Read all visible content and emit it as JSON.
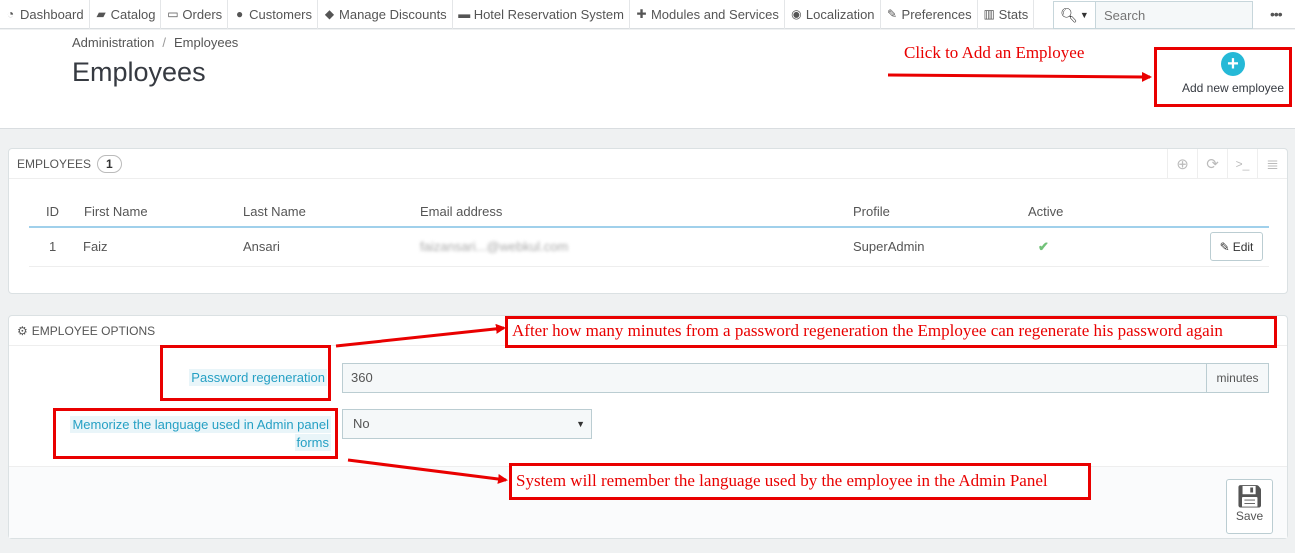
{
  "nav": {
    "items": [
      {
        "label": "Dashboard",
        "icon": "dashboard-icon"
      },
      {
        "label": "Catalog",
        "icon": "book-icon"
      },
      {
        "label": "Orders",
        "icon": "credit-card-icon"
      },
      {
        "label": "Customers",
        "icon": "users-icon"
      },
      {
        "label": "Manage Discounts",
        "icon": "tags-icon"
      },
      {
        "label": "Hotel Reservation System",
        "icon": "bed-icon"
      },
      {
        "label": "Modules and Services",
        "icon": "puzzle-icon"
      },
      {
        "label": "Localization",
        "icon": "globe-icon"
      },
      {
        "label": "Preferences",
        "icon": "wrench-icon"
      },
      {
        "label": "Stats",
        "icon": "bar-chart-icon"
      }
    ],
    "search_placeholder": "Search"
  },
  "header": {
    "breadcrumb": [
      "Administration",
      "Employees"
    ],
    "title": "Employees",
    "add_button_label": "Add new employee"
  },
  "employees_panel": {
    "title": "EMPLOYEES",
    "count": "1",
    "columns": [
      "ID",
      "First Name",
      "Last Name",
      "Email address",
      "Profile",
      "Active"
    ],
    "rows": [
      {
        "id": "1",
        "first_name": "Faiz",
        "last_name": "Ansari",
        "email": "faizansari...@webkul.com",
        "profile": "SuperAdmin",
        "active": true
      }
    ],
    "edit_label": "Edit"
  },
  "options_panel": {
    "title": "EMPLOYEE OPTIONS",
    "password_regeneration_label": "Password regeneration",
    "password_regeneration_value": "360",
    "password_regeneration_unit": "minutes",
    "memorize_language_label_line1": "Memorize the language used in Admin panel",
    "memorize_language_label_line2": "forms",
    "memorize_language_value": "No",
    "save_label": "Save"
  },
  "annotations": {
    "add_employee": "Click to Add an Employee",
    "password_note": "After how many minutes from a password regeneration the Employee can regenerate his password again",
    "language_note": "System will remember the language used by the employee in the Admin Panel",
    "color": "#e90000"
  },
  "colors": {
    "accent": "#25b9d7",
    "active_check": "#72c279",
    "label_blue": "#25a0c4"
  }
}
